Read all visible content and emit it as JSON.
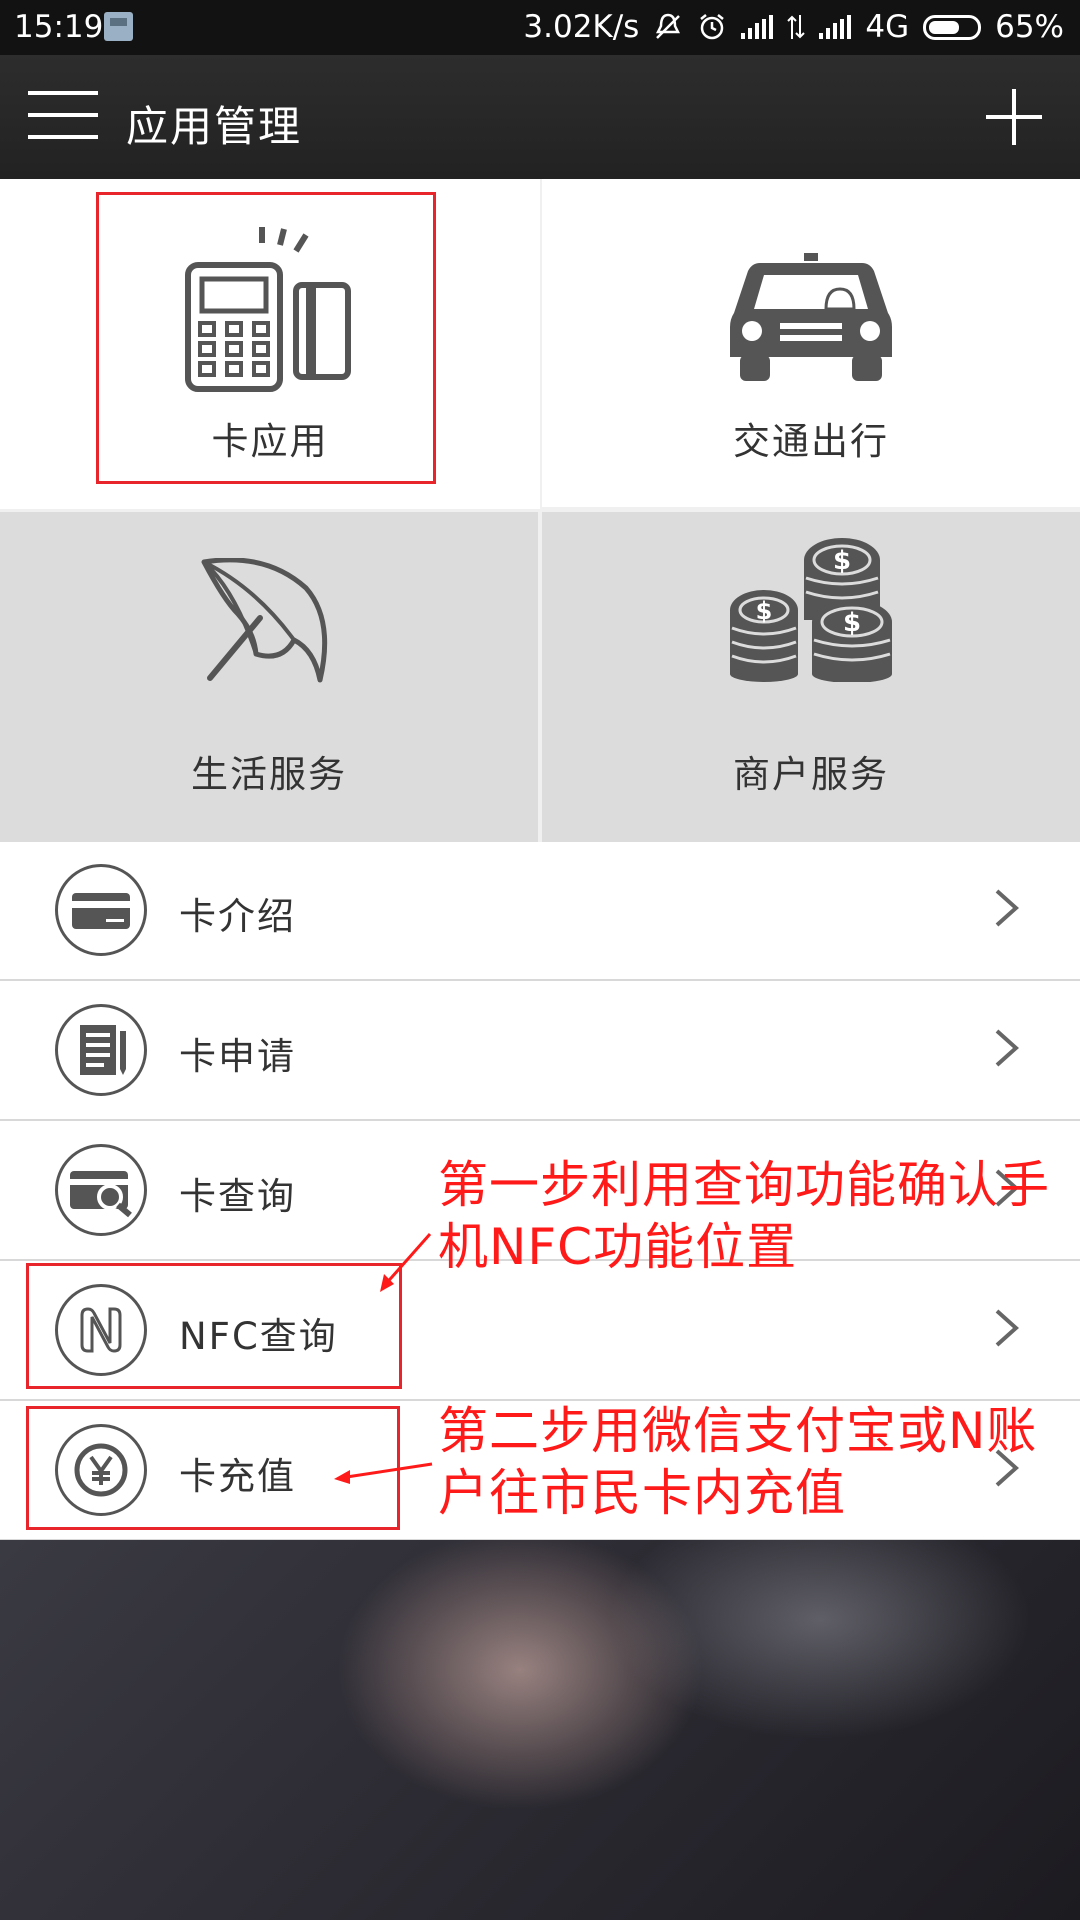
{
  "status_bar": {
    "time": "15:19",
    "net_speed": "3.02K/s",
    "network": "4G",
    "battery_percent": "65%",
    "battery_level": 0.65
  },
  "app_bar": {
    "title": "应用管理"
  },
  "tiles": [
    {
      "label": "卡应用",
      "icon": "card-terminal-icon"
    },
    {
      "label": "交通出行",
      "icon": "car-icon"
    },
    {
      "label": "生活服务",
      "icon": "umbrella-icon"
    },
    {
      "label": "商户服务",
      "icon": "coins-icon"
    }
  ],
  "menu_items": [
    {
      "label": "卡介绍",
      "icon": "card-icon"
    },
    {
      "label": "卡申请",
      "icon": "form-icon"
    },
    {
      "label": "卡查询",
      "icon": "card-search-icon"
    },
    {
      "label": "NFC查询",
      "icon": "nfc-icon"
    },
    {
      "label": "卡充值",
      "icon": "yen-icon"
    }
  ],
  "annotations": {
    "step1": "第一步利用查询功能确认手机NFC功能位置",
    "step1_line1": "第一步利用查询功能确认手",
    "step1_line2": "机NFC功能位置",
    "step2_line1": "第二步用微信支付宝或N账",
    "step2_line2": "户往市民卡内充值"
  },
  "colors": {
    "annotation_red": "#ff1a1a",
    "app_bar": "#262626",
    "tile_gray": "#dcdcdc",
    "icon_gray": "#555555"
  }
}
